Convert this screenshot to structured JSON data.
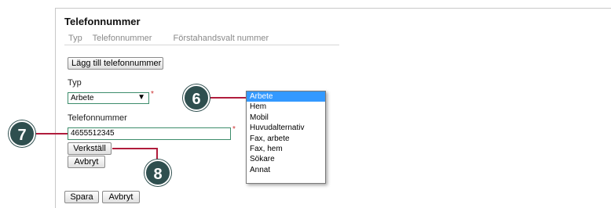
{
  "section": {
    "title": "Telefonnummer",
    "columns": [
      "Typ",
      "Telefonnummer",
      "Förstahandsvalt nummer"
    ]
  },
  "add_button_label": "Lägg till telefonnummer",
  "type_field": {
    "label": "Typ",
    "selected": "Arbete",
    "arrow": "▼",
    "required_mark": "*"
  },
  "type_options": [
    "Arbete",
    "Hem",
    "Mobil",
    "Huvudalternativ",
    "Fax, arbete",
    "Fax, hem",
    "Sökare",
    "Annat"
  ],
  "phone_field": {
    "label": "Telefonnummer",
    "value": "4655512345",
    "required_mark": "*"
  },
  "apply_button_label": "Verkställ",
  "cancel_button_label": "Avbryt",
  "save_button_label": "Spara",
  "cancel_bottom_label": "Avbryt",
  "callouts": {
    "six": "6",
    "seven": "7",
    "eight": "8",
    "color": "#2f4f4f",
    "line_color": "#b01c3c"
  },
  "colors": {
    "selected_option": "#3399ff",
    "field_border": "#3c8c6b"
  }
}
